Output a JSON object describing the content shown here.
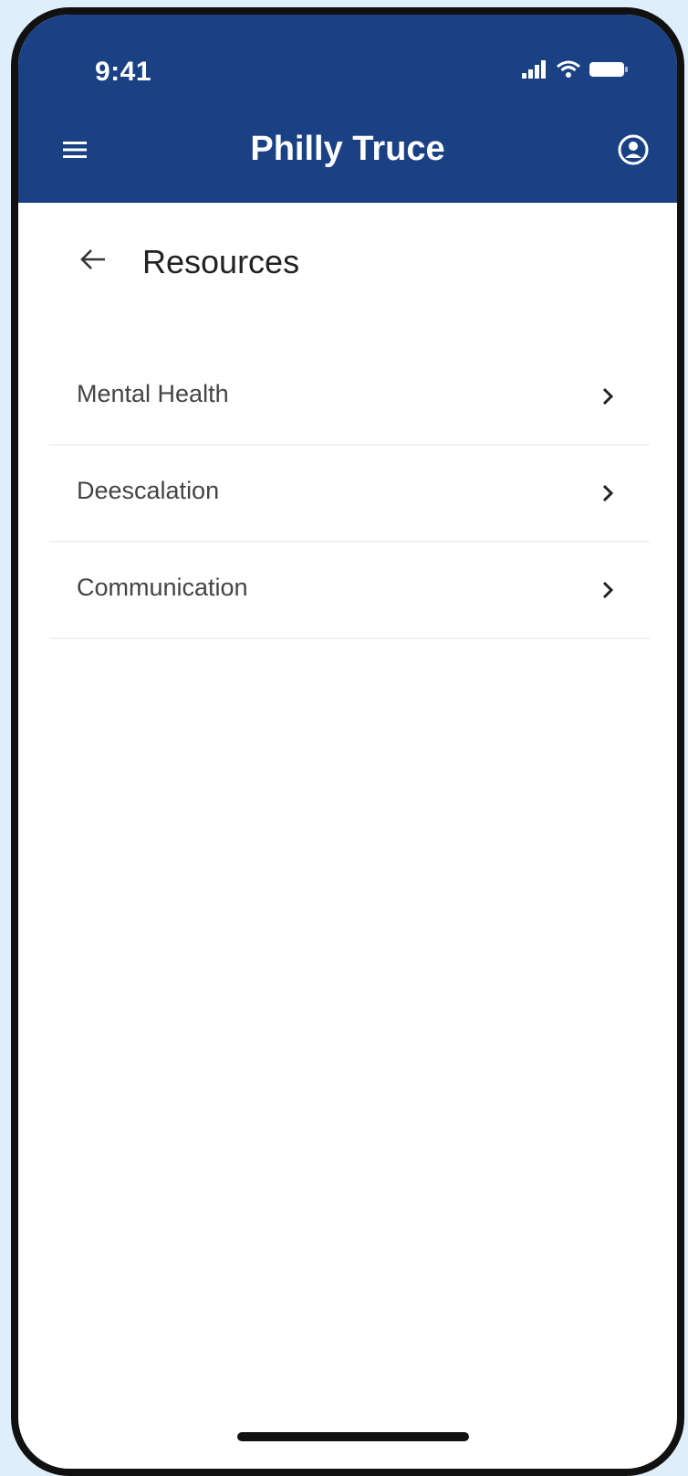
{
  "status_bar": {
    "time": "9:41",
    "icons": [
      "signal-icon",
      "wifi-icon",
      "battery-icon"
    ]
  },
  "header": {
    "title": "Philly Truce",
    "menu_icon": "hamburger-menu-icon",
    "account_icon": "account-circle-icon",
    "background_color": "#1b4185"
  },
  "page": {
    "title": "Resources",
    "back_icon": "back-arrow-icon"
  },
  "resources": {
    "items": [
      {
        "label": "Mental Health"
      },
      {
        "label": "Deescalation"
      },
      {
        "label": "Communication"
      }
    ]
  }
}
